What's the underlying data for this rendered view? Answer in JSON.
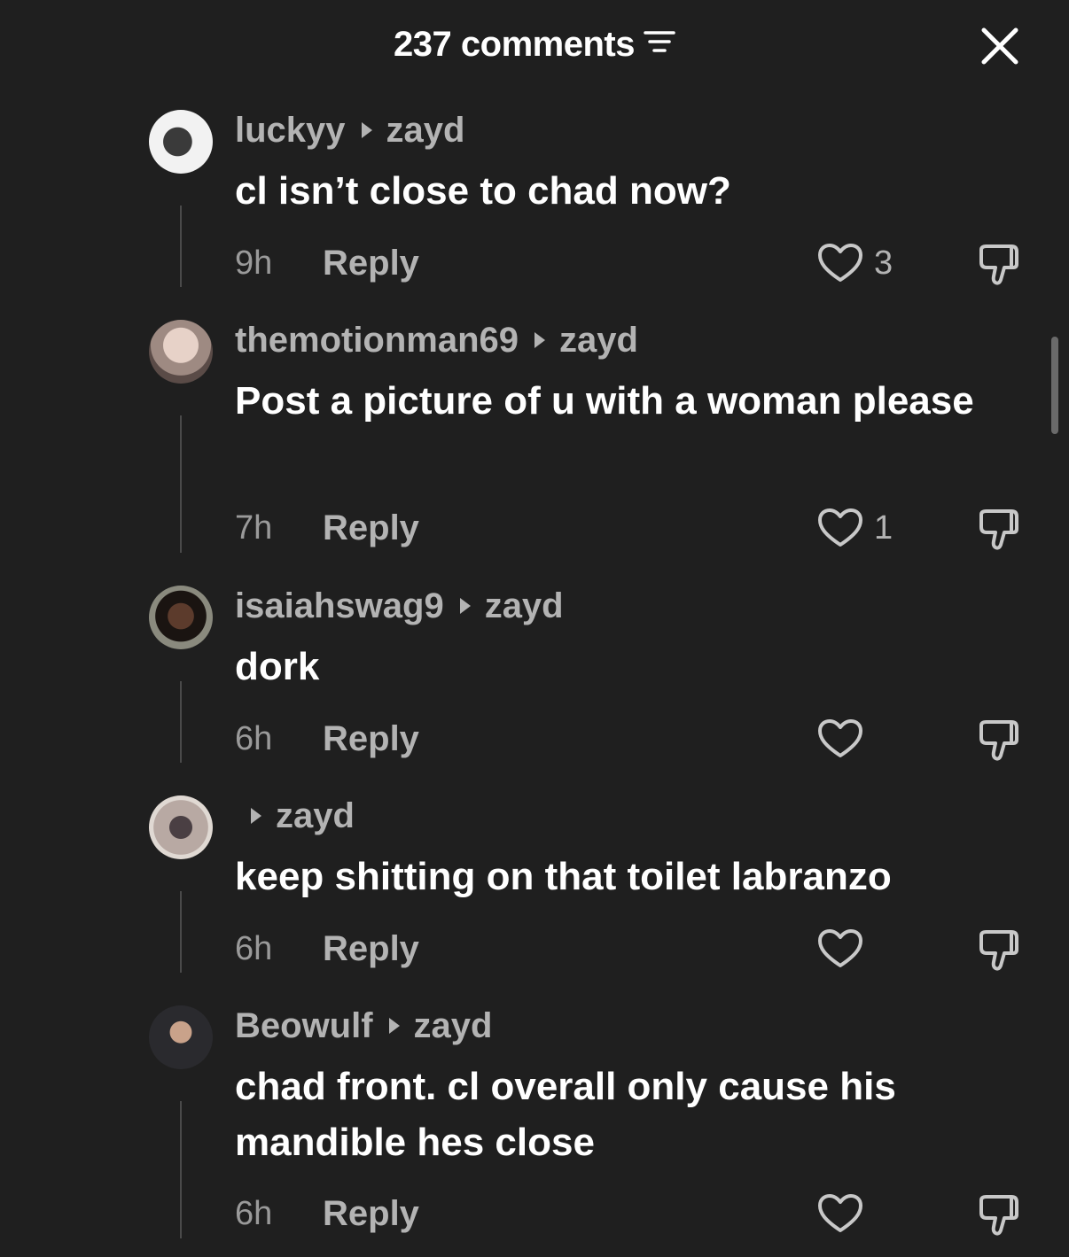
{
  "header": {
    "title": "237 comments",
    "sort_icon": "sort-lines-icon",
    "close_icon": "close-icon"
  },
  "comments": [
    {
      "username": "luckyy",
      "reply_to": "zayd",
      "text": "cl isn’t close to chad now?",
      "time": "9h",
      "reply_label": "Reply",
      "likes": "3"
    },
    {
      "username": "themotionman69",
      "reply_to": "zayd",
      "text": "Post a picture of u with a woman please",
      "time": "7h",
      "reply_label": "Reply",
      "likes": "1"
    },
    {
      "username": "isaiahswag9",
      "reply_to": "zayd",
      "text": "dork",
      "time": "6h",
      "reply_label": "Reply",
      "likes": ""
    },
    {
      "username": "",
      "reply_to": "zayd",
      "text": "keep shitting on that toilet labranzo",
      "time": "6h",
      "reply_label": "Reply",
      "likes": ""
    },
    {
      "username": "Beowulf",
      "reply_to": "zayd",
      "text": "chad front. cl overall only cause his mandible hes close",
      "time": "6h",
      "reply_label": "Reply",
      "likes": ""
    }
  ],
  "colors": {
    "background": "#1f1f1f",
    "primary_text": "#ffffff",
    "secondary_text": "#b3b3b3",
    "time_text": "#9a9a9a"
  }
}
